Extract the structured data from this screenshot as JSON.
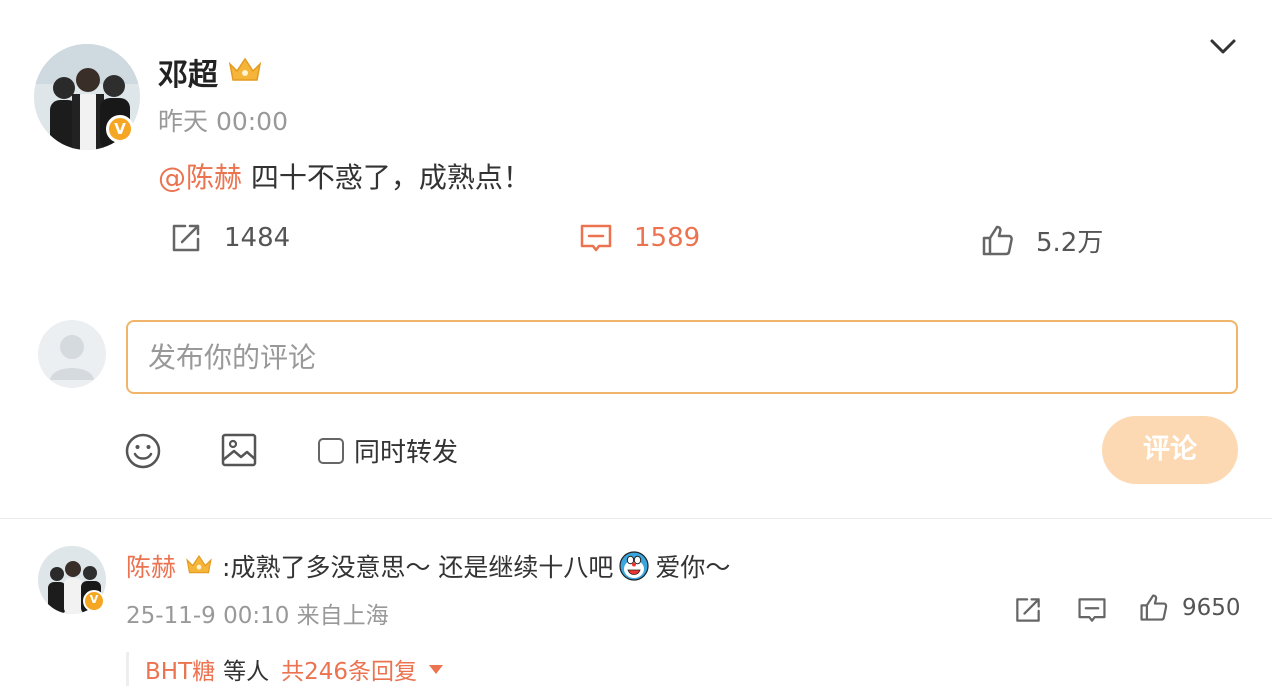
{
  "post": {
    "author": "邓超",
    "time": "昨天 00:00",
    "mention": "@陈赫",
    "text": " 四十不惑了，成熟点！",
    "actions": {
      "repost_count": "1484",
      "comment_count": "1589",
      "like_count": "5.2万"
    }
  },
  "composer": {
    "placeholder": "发布你的评论",
    "also_repost_label": "同时转发",
    "submit_label": "评论"
  },
  "comment": {
    "author": "陈赫",
    "text_1": ":成熟了多没意思～ 还是继续十八吧",
    "text_2": " 爱你～",
    "meta": "25-11-9 00:10 来自上海",
    "like_count": "9650",
    "replies": {
      "first_replier": "BHT糖",
      "etc_label": "等人",
      "count_label": "共246条回复"
    }
  },
  "colors": {
    "accent": "#eb7350",
    "input_border": "#f0b56a",
    "submit_disabled": "#fcd9b3",
    "verified_badge": "#f5a623"
  },
  "icons": {
    "verified": "V"
  }
}
